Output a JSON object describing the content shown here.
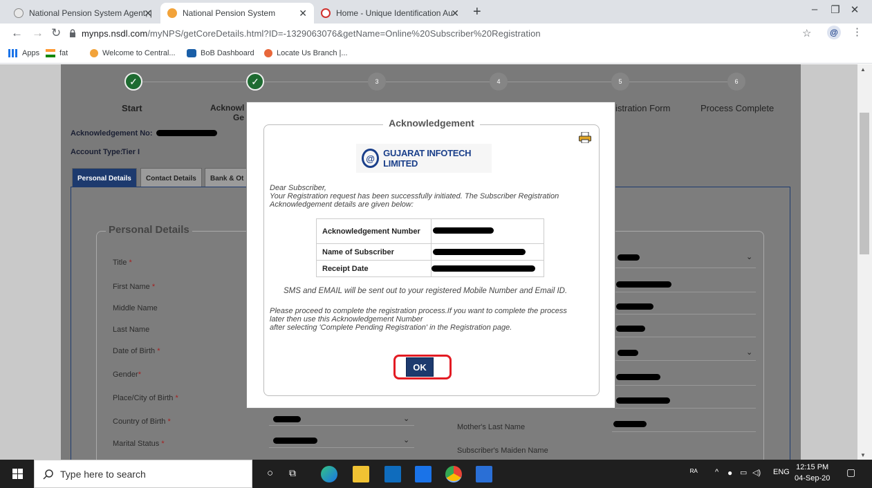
{
  "browser": {
    "tabs": [
      {
        "title": "National Pension System Agent, |"
      },
      {
        "title": "National Pension System"
      },
      {
        "title": "Home - Unique Identification Au"
      }
    ],
    "url_host": "mynps.nsdl.com",
    "url_path": "/myNPS/getCoreDetails.html?ID=-1329063076&getName=Online%20Subscriber%20Registration",
    "bookmarks": [
      "Apps",
      "fat",
      "Welcome to Central...",
      "BoB Dashboard",
      "Locate Us Branch |..."
    ]
  },
  "stepper": {
    "steps": [
      {
        "num": "✓",
        "label": "Start"
      },
      {
        "num": "✓",
        "label": "Acknowl"
      },
      {
        "num": "3",
        "label": ""
      },
      {
        "num": "4",
        "label": ""
      },
      {
        "num": "5",
        "label": "istration Form"
      },
      {
        "num": "6",
        "label": "Process Complete"
      }
    ],
    "label2_line2": "Ge"
  },
  "form": {
    "ack_label": "Acknowledgement No:",
    "account_type_label": "Account Type:",
    "account_type_value": "Tier I",
    "tabs": [
      "Personal Details",
      "Contact Details",
      "Bank & Ot"
    ],
    "section_title": "Personal Details",
    "fields_left": [
      "Title",
      "First Name",
      "Middle Name",
      "Last Name",
      "Date of Birth",
      "Gender",
      "Place/City of Birth",
      "Country of Birth",
      "Marital Status"
    ],
    "fields_right": [
      "Mother's Last Name",
      "Subscriber's Maiden Name"
    ]
  },
  "modal": {
    "title": "Acknowledgement",
    "logo_text": "GUJARAT INFOTECH LIMITED",
    "greeting": "Dear Subscriber,",
    "intro_line1": "Your Registration request has been successfully initiated. The Subscriber Registration",
    "intro_line2": "Acknowledgement details are given below:",
    "table_rows": [
      {
        "label": "Acknowledgement Number"
      },
      {
        "label": "Name of Subscriber"
      },
      {
        "label": "Receipt Date"
      }
    ],
    "sms_note": "SMS and EMAIL will be sent out to your registered Mobile Number and Email ID.",
    "proceed_line1": "Please proceed to complete the registration process.If you want to complete the process",
    "proceed_line2": "later then use this Acknowledgement Number",
    "proceed_line3": "after selecting 'Complete Pending Registration' in the Registration page.",
    "ok_label": "OK"
  },
  "taskbar": {
    "search_placeholder": "Type here to search",
    "lang": "ENG",
    "time": "12:15 PM",
    "date": "04-Sep-20"
  }
}
